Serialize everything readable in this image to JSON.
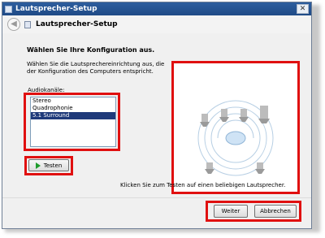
{
  "window": {
    "title": "Lautsprecher-Setup",
    "close_label": "✕"
  },
  "navbar": {
    "title": "Lautsprecher-Setup",
    "back_label": "◀"
  },
  "main": {
    "heading": "Wählen Sie Ihre Konfiguration aus.",
    "description": "Wählen Sie die Lautsprechereinrichtung aus, die der Konfiguration des Computers entspricht.",
    "channels_label": "Audiokanäle:",
    "channel_options": [
      "Stereo",
      "Quadrophonie",
      "5.1 Surround"
    ],
    "selected_channel": "5.1 Surround",
    "test_button": "Testen",
    "hint": "Klicken Sie zum Testen auf einen beliebigen Lautsprecher."
  },
  "footer": {
    "next_label": "Weiter",
    "cancel_label": "Abbrechen"
  },
  "colors": {
    "highlight": "#e01010",
    "selection": "#1f3a7a",
    "title_bar": "#1f4a86"
  },
  "icons": {
    "test": "play-icon",
    "back": "back-arrow-icon",
    "close": "close-icon",
    "speaker": "speaker-icon"
  }
}
